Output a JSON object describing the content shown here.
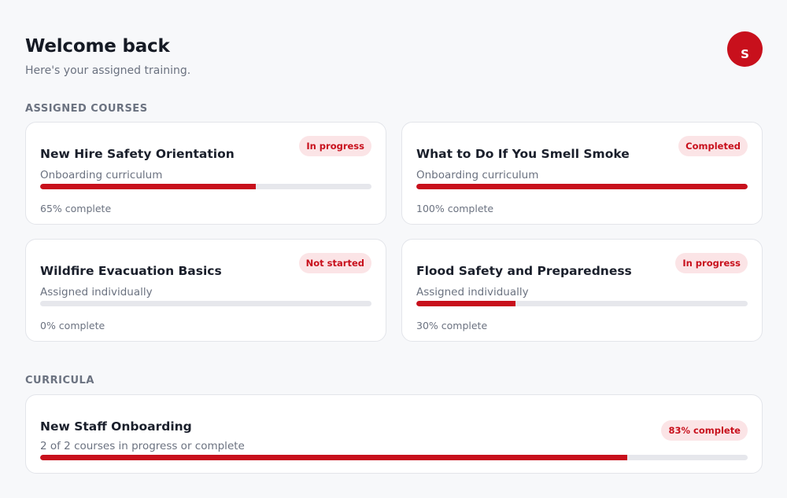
{
  "header": {
    "title": "Welcome back",
    "subtitle": "Here's your assigned training.",
    "avatar_initial": "S"
  },
  "sections": {
    "assigned": "ASSIGNED COURSES",
    "curricula": "CURRICULA"
  },
  "courses": [
    {
      "title": "New Hire Safety Orientation",
      "subtitle": "Onboarding curriculum",
      "status": "In progress",
      "progress": 0.65,
      "progress_label": "65% complete"
    },
    {
      "title": "What to Do If You Smell Smoke",
      "subtitle": "Onboarding curriculum",
      "status": "Completed",
      "progress": 1.0,
      "progress_label": "100% complete"
    },
    {
      "title": "Wildfire Evacuation Basics",
      "subtitle": "Assigned individually",
      "status": "Not started",
      "progress": 0.0,
      "progress_label": "0% complete"
    },
    {
      "title": "Flood Safety and Preparedness",
      "subtitle": "Assigned individually",
      "status": "In progress",
      "progress": 0.3,
      "progress_label": "30% complete"
    }
  ],
  "curricula": [
    {
      "title": "New Staff Onboarding",
      "subtitle": "2 of 2 courses in progress or complete",
      "badge": "83% complete",
      "progress": 0.83
    }
  ],
  "colors": {
    "accent": "#c8101c",
    "badge_bg": "#fbe4e6",
    "track": "#e6e7ec"
  }
}
